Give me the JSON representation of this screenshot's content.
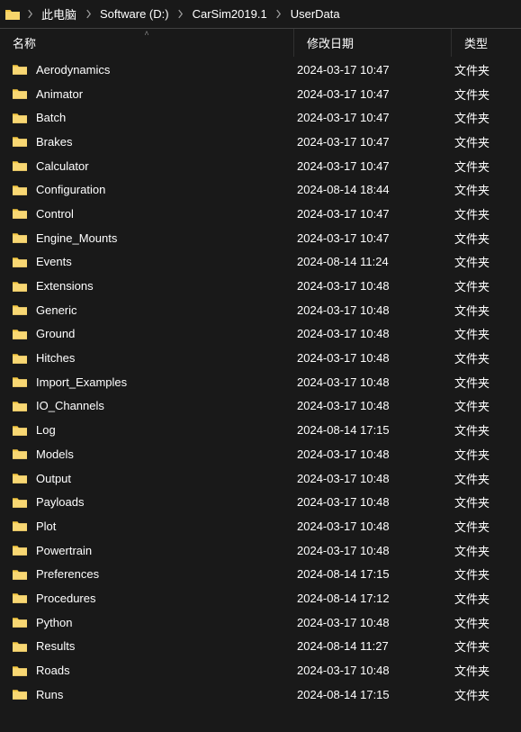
{
  "breadcrumb": {
    "items": [
      {
        "label": "此电脑"
      },
      {
        "label": "Software (D:)"
      },
      {
        "label": "CarSim2019.1"
      },
      {
        "label": "UserData"
      }
    ]
  },
  "columns": {
    "name": "名称",
    "date": "修改日期",
    "type": "类型"
  },
  "entries": [
    {
      "name": "Aerodynamics",
      "date": "2024-03-17 10:47",
      "type": "文件夹"
    },
    {
      "name": "Animator",
      "date": "2024-03-17 10:47",
      "type": "文件夹"
    },
    {
      "name": "Batch",
      "date": "2024-03-17 10:47",
      "type": "文件夹"
    },
    {
      "name": "Brakes",
      "date": "2024-03-17 10:47",
      "type": "文件夹"
    },
    {
      "name": "Calculator",
      "date": "2024-03-17 10:47",
      "type": "文件夹"
    },
    {
      "name": "Configuration",
      "date": "2024-08-14 18:44",
      "type": "文件夹"
    },
    {
      "name": "Control",
      "date": "2024-03-17 10:47",
      "type": "文件夹"
    },
    {
      "name": "Engine_Mounts",
      "date": "2024-03-17 10:47",
      "type": "文件夹"
    },
    {
      "name": "Events",
      "date": "2024-08-14 11:24",
      "type": "文件夹"
    },
    {
      "name": "Extensions",
      "date": "2024-03-17 10:48",
      "type": "文件夹"
    },
    {
      "name": "Generic",
      "date": "2024-03-17 10:48",
      "type": "文件夹"
    },
    {
      "name": "Ground",
      "date": "2024-03-17 10:48",
      "type": "文件夹"
    },
    {
      "name": "Hitches",
      "date": "2024-03-17 10:48",
      "type": "文件夹"
    },
    {
      "name": "Import_Examples",
      "date": "2024-03-17 10:48",
      "type": "文件夹"
    },
    {
      "name": "IO_Channels",
      "date": "2024-03-17 10:48",
      "type": "文件夹"
    },
    {
      "name": "Log",
      "date": "2024-08-14 17:15",
      "type": "文件夹"
    },
    {
      "name": "Models",
      "date": "2024-03-17 10:48",
      "type": "文件夹"
    },
    {
      "name": "Output",
      "date": "2024-03-17 10:48",
      "type": "文件夹"
    },
    {
      "name": "Payloads",
      "date": "2024-03-17 10:48",
      "type": "文件夹"
    },
    {
      "name": "Plot",
      "date": "2024-03-17 10:48",
      "type": "文件夹"
    },
    {
      "name": "Powertrain",
      "date": "2024-03-17 10:48",
      "type": "文件夹"
    },
    {
      "name": "Preferences",
      "date": "2024-08-14 17:15",
      "type": "文件夹"
    },
    {
      "name": "Procedures",
      "date": "2024-08-14 17:12",
      "type": "文件夹"
    },
    {
      "name": "Python",
      "date": "2024-03-17 10:48",
      "type": "文件夹"
    },
    {
      "name": "Results",
      "date": "2024-08-14 11:27",
      "type": "文件夹"
    },
    {
      "name": "Roads",
      "date": "2024-03-17 10:48",
      "type": "文件夹"
    },
    {
      "name": "Runs",
      "date": "2024-08-14 17:15",
      "type": "文件夹"
    }
  ]
}
